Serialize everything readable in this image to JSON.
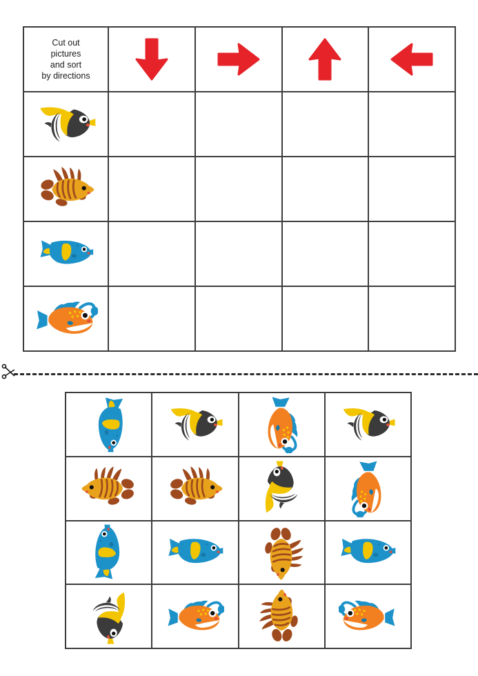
{
  "worksheet": {
    "instructions": "Cut out\npictures\nand sort\nby directions",
    "cut_line_icon": "scissors-icon",
    "arrow_color": "#E52329",
    "grid_line_color": "#3C3C3C"
  },
  "sort_table": {
    "columns": [
      {
        "id": "labels",
        "icon": "",
        "label": "Cut out pictures and sort by directions"
      },
      {
        "id": "down",
        "icon": "arrow-down-icon",
        "label": "down"
      },
      {
        "id": "right",
        "icon": "arrow-right-icon",
        "label": "right"
      },
      {
        "id": "up",
        "icon": "arrow-up-icon",
        "label": "up"
      },
      {
        "id": "left",
        "icon": "arrow-left-icon",
        "label": "left"
      }
    ],
    "rows": [
      {
        "fish": "moorish-idol",
        "label": "Moorish idol fish"
      },
      {
        "fish": "lionfish",
        "label": "Lionfish"
      },
      {
        "fish": "angelfish",
        "label": "Blue angelfish"
      },
      {
        "fish": "anglerfish",
        "label": "Anglerfish"
      }
    ]
  },
  "card_grid": {
    "rows": [
      [
        {
          "fish": "angelfish",
          "direction": "down",
          "rotation": 90,
          "flip": false
        },
        {
          "fish": "moorish-idol",
          "direction": "left",
          "rotation": 0,
          "flip": false
        },
        {
          "fish": "anglerfish",
          "direction": "down",
          "rotation": 90,
          "flip": false
        },
        {
          "fish": "moorish-idol",
          "direction": "left",
          "rotation": 0,
          "flip": false
        }
      ],
      [
        {
          "fish": "lionfish",
          "direction": "right",
          "rotation": 0,
          "flip": true
        },
        {
          "fish": "lionfish",
          "direction": "left",
          "rotation": 0,
          "flip": false
        },
        {
          "fish": "moorish-idol",
          "direction": "up",
          "rotation": 270,
          "flip": false
        },
        {
          "fish": "anglerfish",
          "direction": "down",
          "rotation": 90,
          "flip": true
        }
      ],
      [
        {
          "fish": "angelfish",
          "direction": "up",
          "rotation": 270,
          "flip": false
        },
        {
          "fish": "angelfish",
          "direction": "left",
          "rotation": 0,
          "flip": false
        },
        {
          "fish": "lionfish",
          "direction": "down",
          "rotation": 90,
          "flip": false
        },
        {
          "fish": "angelfish",
          "direction": "left",
          "rotation": 0,
          "flip": false
        }
      ],
      [
        {
          "fish": "moorish-idol",
          "direction": "down",
          "rotation": 90,
          "flip": false
        },
        {
          "fish": "anglerfish",
          "direction": "left",
          "rotation": 0,
          "flip": false
        },
        {
          "fish": "lionfish",
          "direction": "up",
          "rotation": 270,
          "flip": false
        },
        {
          "fish": "anglerfish",
          "direction": "right",
          "rotation": 0,
          "flip": true
        }
      ]
    ]
  },
  "colors": {
    "fish_yellow": "#F2C500",
    "fish_dark": "#3B3B3B",
    "fish_blue": "#1D92C9",
    "fish_orange": "#F28021",
    "fish_gold": "#E8A21C",
    "fish_brown": "#9E4A1E",
    "eye_black": "#111111",
    "mouth_red": "#E0503C"
  }
}
